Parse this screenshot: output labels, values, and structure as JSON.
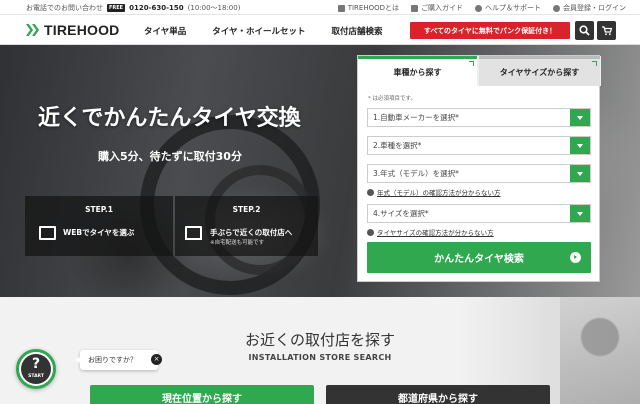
{
  "topbar": {
    "contact_label": "お電話でのお問い合わせ",
    "freedial_label": "FREE",
    "phone": "0120-630-150",
    "hours": "(10:00～18:00)",
    "links": [
      {
        "label": "TIREHOODとは",
        "icon": "shield-icon"
      },
      {
        "label": "ご購入ガイド",
        "icon": "book-icon"
      },
      {
        "label": "ヘルプ＆サポート",
        "icon": "help-icon"
      },
      {
        "label": "会員登録・ログイン",
        "icon": "user-icon"
      }
    ]
  },
  "header": {
    "logo": "TIREHOOD",
    "nav": [
      "タイヤ単品",
      "タイヤ・ホイールセット",
      "取付店舗検索"
    ],
    "promo": "すべてのタイヤに無料でパンク保証付き！",
    "search_icon": "search-icon",
    "cart_icon": "cart-icon"
  },
  "hero": {
    "title": "近くでかんたんタイヤ交換",
    "subtitle": "購入5分、待たずに取付30分",
    "steps": [
      {
        "num": "STEP.1",
        "text": "WEBでタイヤを選ぶ",
        "note": "",
        "icon": "monitor-icon"
      },
      {
        "num": "STEP.2",
        "text": "手ぶらで近くの取付店へ",
        "note": "※自宅配送も可能です",
        "icon": "store-icon"
      }
    ]
  },
  "search_panel": {
    "tabs": [
      "車種から探す",
      "タイヤサイズから探す"
    ],
    "active_tab": "車種から探す",
    "required_note": "* は必須項目です。",
    "selects": [
      "1.自動車メーカーを選択*",
      "2.車種を選択*",
      "3.年式（モデル）を選択*",
      "4.サイズを選択*"
    ],
    "help_links": [
      "年式（モデル）の確認方法が分からない方",
      "タイヤサイズの確認方法が分からない方"
    ],
    "submit": "かんたんタイヤ検索"
  },
  "store_section": {
    "title": "お近くの取付店を探す",
    "title_en": "INSTALLATION STORE SEARCH",
    "buttons": [
      "現在位置から探す",
      "都道府県から探す"
    ]
  },
  "chat": {
    "symbol": "?",
    "start": "START",
    "bubble": "お困りですか？",
    "close": "×"
  },
  "colors": {
    "accent": "#2fa84f",
    "promo": "#d8232a",
    "dark": "#333333"
  }
}
